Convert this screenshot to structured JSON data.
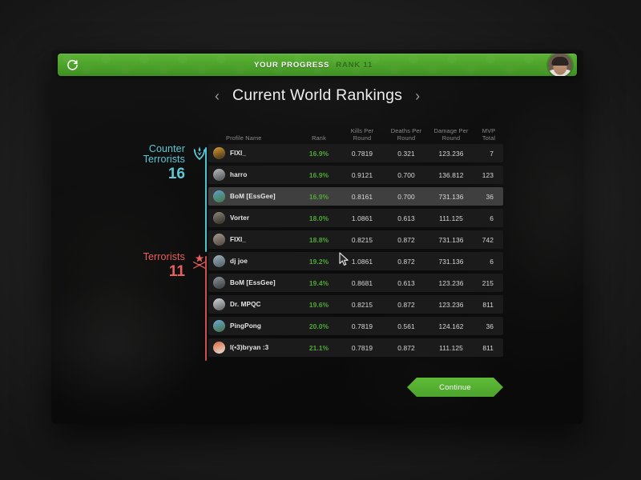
{
  "window": {
    "progress_bar": {
      "logo_icon": "refresh-circle-icon",
      "title": "YOUR PROGRESS",
      "rank": "RANK 11",
      "avatar_icon": "user-avatar",
      "bar_color": "#4da32b",
      "title_color": "#ffffff",
      "rank_color": "#2e6b19"
    },
    "page_header": {
      "prev_icon": "chevron-left-icon",
      "title": "Current World Rankings",
      "next_icon": "chevron-right-icon"
    },
    "teams": [
      {
        "id": "counter-terrorists",
        "name_line1": "Counter",
        "name_line2": "Terrorists",
        "score": "16",
        "color": "#5fc8d6",
        "logo_icon": "counter-terrorist-logo-icon"
      },
      {
        "id": "terrorists",
        "name_line1": "Terrorists",
        "name_line2": "",
        "score": "11",
        "color": "#e8605e",
        "logo_icon": "terrorist-logo-icon"
      }
    ],
    "table": {
      "headers": {
        "name": "Profile Name",
        "rank": "Rank",
        "kpr_line1": "Kills Per",
        "kpr_line2": "Round",
        "dpr_line1": "Deaths Per",
        "dpr_line2": "Round",
        "dmg_line1": "Damage Per",
        "dmg_line2": "Round",
        "mvp_line1": "MVP",
        "mvp_line2": "Total"
      },
      "rank_color": "#4fa838",
      "rows": [
        {
          "name": "FIXI_",
          "rank": "16.9%",
          "kpr": "0.7819",
          "dpr": "0.321",
          "dmg": "123.236",
          "mvp": "7",
          "team": "counter-terrorists",
          "hovered": false,
          "avatar_colors": [
            "#d79a33",
            "#3a2c18"
          ]
        },
        {
          "name": "harro",
          "rank": "16.9%",
          "kpr": "0.9121",
          "dpr": "0.700",
          "dmg": "136.812",
          "mvp": "123",
          "team": "counter-terrorists",
          "hovered": false,
          "avatar_colors": [
            "#b9bcbe",
            "#4a4d50"
          ]
        },
        {
          "name": "BoM [EssGee]",
          "rank": "16.9%",
          "kpr": "0.8161",
          "dpr": "0.700",
          "dmg": "731.136",
          "mvp": "36",
          "team": "counter-terrorists",
          "hovered": true,
          "avatar_colors": [
            "#5e9fc7",
            "#3f7a43"
          ]
        },
        {
          "name": "Vorter",
          "rank": "18.0%",
          "kpr": "1.0861",
          "dpr": "0.613",
          "dmg": "111.125",
          "mvp": "6",
          "team": "counter-terrorists",
          "hovered": false,
          "avatar_colors": [
            "#8d8578",
            "#2e2a25"
          ]
        },
        {
          "name": "FIXI_",
          "rank": "18.8%",
          "kpr": "0.8215",
          "dpr": "0.872",
          "dmg": "731.136",
          "mvp": "742",
          "team": "counter-terrorists",
          "hovered": false,
          "avatar_colors": [
            "#a59a8c",
            "#4c443c"
          ]
        },
        {
          "name": "dj joe",
          "rank": "19.2%",
          "kpr": "1.0861",
          "dpr": "0.872",
          "dmg": "731.136",
          "mvp": "6",
          "team": "terrorists",
          "hovered": false,
          "avatar_colors": [
            "#9fb2bd",
            "#4e5a62"
          ]
        },
        {
          "name": "BoM [EssGee]",
          "rank": "19.4%",
          "kpr": "0.8681",
          "dpr": "0.613",
          "dmg": "123.236",
          "mvp": "215",
          "team": "terrorists",
          "hovered": false,
          "avatar_colors": [
            "#8f949a",
            "#33373b"
          ]
        },
        {
          "name": "Dr. MPQC",
          "rank": "19.6%",
          "kpr": "0.8215",
          "dpr": "0.872",
          "dmg": "123.236",
          "mvp": "811",
          "team": "terrorists",
          "hovered": false,
          "avatar_colors": [
            "#d3d5d6",
            "#5b5e60"
          ]
        },
        {
          "name": "PingPong",
          "rank": "20.0%",
          "kpr": "0.7819",
          "dpr": "0.561",
          "dmg": "124.162",
          "mvp": "36",
          "team": "terrorists",
          "hovered": false,
          "avatar_colors": [
            "#6aa8d8",
            "#41713f"
          ]
        },
        {
          "name": "l(•3)bryan :3",
          "rank": "21.1%",
          "kpr": "0.7819",
          "dpr": "0.872",
          "dmg": "111.125",
          "mvp": "811",
          "team": "terrorists",
          "hovered": false,
          "avatar_colors": [
            "#d9643a",
            "#e8e2d6"
          ]
        }
      ]
    },
    "continue_button": {
      "label": "Continue",
      "color": "#4ca42c"
    },
    "cursor_icon": "mouse-pointer-icon"
  }
}
